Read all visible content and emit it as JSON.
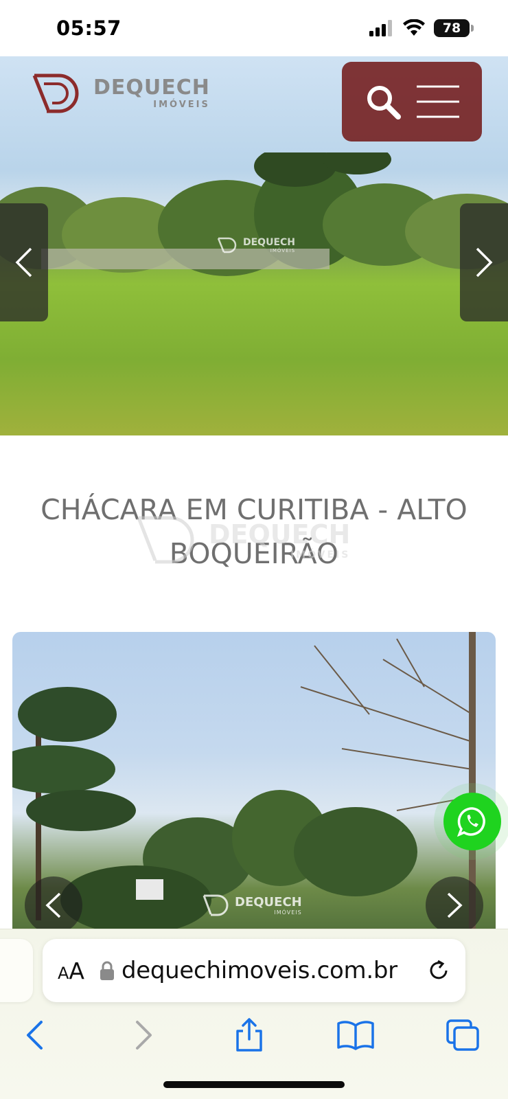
{
  "status_bar": {
    "time": "05:57",
    "battery": "78",
    "icons": [
      "cellular-signal-icon",
      "wifi-icon",
      "battery-icon"
    ]
  },
  "header": {
    "logo_name": "DEQUECH",
    "logo_subtitle": "IMÓVEIS",
    "search_icon": "search-icon",
    "menu_icon": "hamburger-menu-icon",
    "accent_color": "#731b1b"
  },
  "hero": {
    "watermark_name": "DEQUECH",
    "watermark_subtitle": "IMÓVEIS"
  },
  "listing": {
    "title_line1": "CHÁCARA EM CURITIBA - ALTO",
    "title_line2": "BOQUEIRÃO",
    "watermark_name": "DEQUECH",
    "watermark_subtitle": "IMÓVEIS"
  },
  "gallery": {
    "watermark_name": "DEQUECH",
    "watermark_subtitle": "IMÓVEIS"
  },
  "whatsapp": {
    "icon": "whatsapp-icon",
    "color": "#1fd31f"
  },
  "browser": {
    "aa_small": "A",
    "aa_big": "A",
    "url": "dequechimoveis.com.br",
    "accent_color": "#1a73e8"
  }
}
